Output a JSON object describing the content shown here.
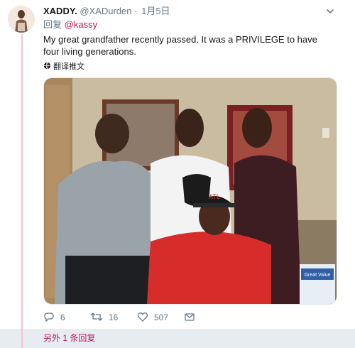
{
  "tweet": {
    "display_name": "XADDY.",
    "handle": "@XADurden",
    "separator": "·",
    "time": "1月5日",
    "reply_prefix": "回复",
    "reply_to": "@kassy",
    "text": "My great grandfather recently passed. It was a PRIVILEGE to have four living generations.",
    "translate_label": "翻译推文"
  },
  "actions": {
    "replies": "6",
    "retweets": "16",
    "likes": "507"
  },
  "thread": {
    "more_replies": "另外 1 条回复"
  },
  "photo": {
    "cap_text": "ATL",
    "box_text": "Great Value"
  },
  "colors": {
    "accent": "#c2185b",
    "thread_line": "#f5c4d4",
    "muted": "#657786"
  },
  "icons": [
    "chevron-down-icon",
    "globe-icon",
    "reply-icon",
    "retweet-icon",
    "like-icon",
    "share-icon"
  ]
}
